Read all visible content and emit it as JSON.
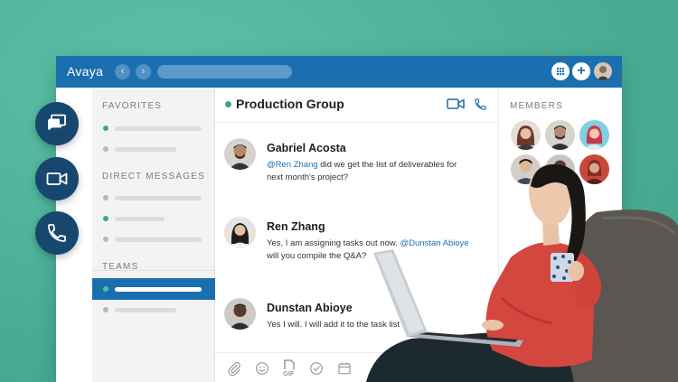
{
  "window": {
    "app_name": "Avaya",
    "search_value": ""
  },
  "sidebar": {
    "favorites_title": "FAVORITES",
    "direct_messages_title": "DIRECT MESSAGES",
    "teams_title": "TEAMS"
  },
  "conversation": {
    "group_name": "Production Group",
    "messages": [
      {
        "sender": "Gabriel Acosta",
        "mention": "@Ren Zhang",
        "text": " did we get the list of deliverables for next month's project?"
      },
      {
        "sender": "Ren Zhang",
        "text_before": "Yes, I am assigning tasks out now. ",
        "mention": "@Dunstan Abioye",
        "text_after": " will you compile the Q&A?"
      },
      {
        "sender": "Dunstan Abioye",
        "text": "Yes I will. I will add it to the task list"
      }
    ],
    "composer_gif_label": "GIF"
  },
  "members": {
    "title": "MEMBERS"
  },
  "colors": {
    "titlebar": "#1b6faf",
    "accent_green": "#41a58a",
    "background_teal": "#4eb39a",
    "fab_navy": "#17476e"
  },
  "icons": {
    "fab_chat": "chat-bubbles-icon",
    "fab_video": "video-camera-icon",
    "fab_phone": "phone-icon",
    "header_video": "video-camera-icon",
    "header_phone": "phone-icon",
    "composer": [
      "paperclip-icon",
      "emoji-icon",
      "gif-icon",
      "checkmark-circle-icon",
      "calendar-icon"
    ]
  }
}
